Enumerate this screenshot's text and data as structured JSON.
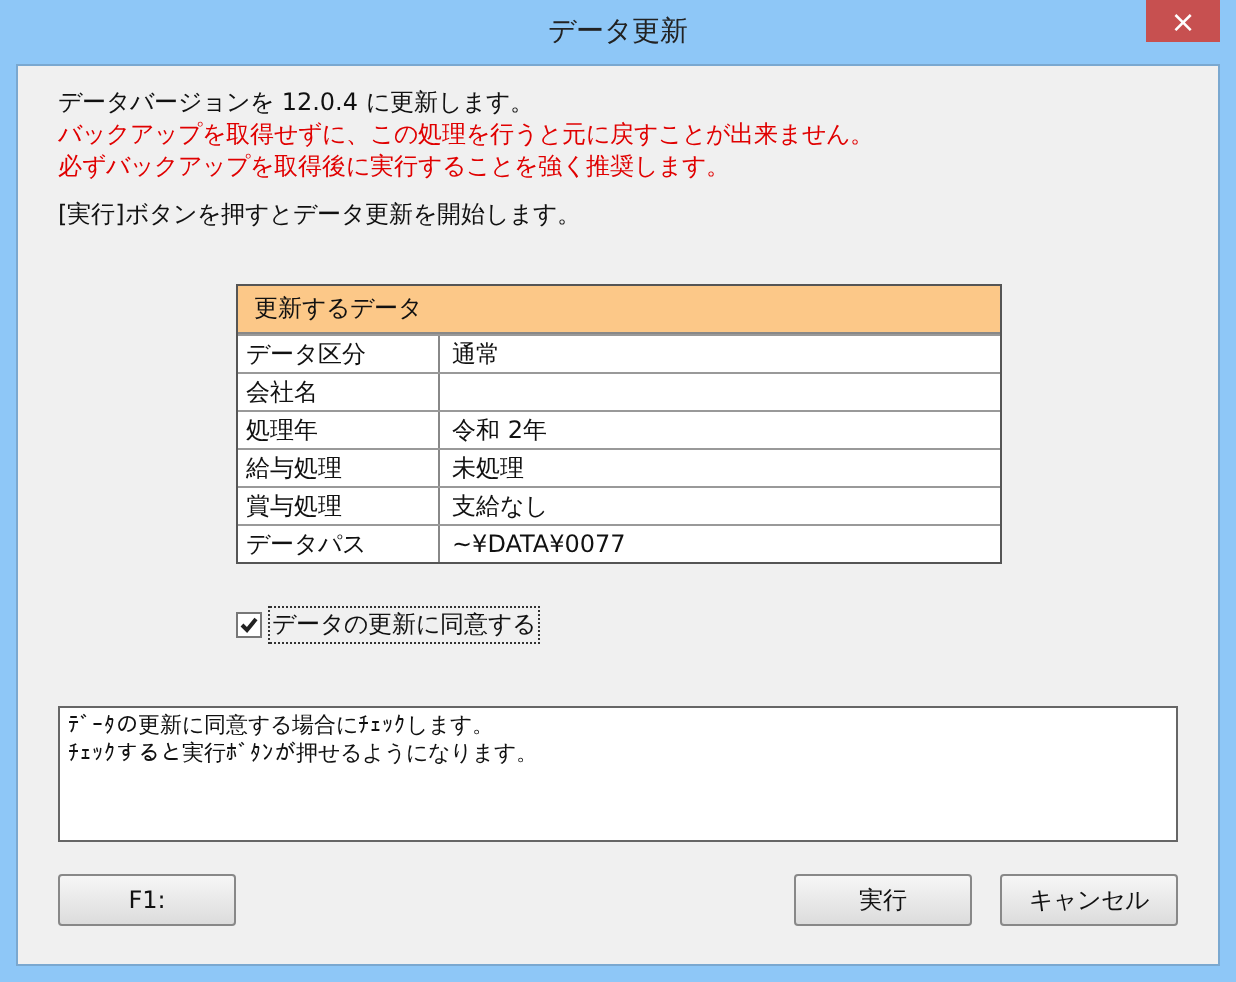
{
  "window": {
    "title": "データ更新",
    "close": "×"
  },
  "messages": [
    {
      "text": "データバージョンを 12.0.4 に更新します。",
      "kind": "normal"
    },
    {
      "text": "バックアップを取得せずに、この処理を行うと元に戻すことが出来ません。",
      "kind": "warning"
    },
    {
      "text": "必ずバックアップを取得後に実行することを強く推奨します。",
      "kind": "warning"
    }
  ],
  "instruction": "[実行]ボタンを押すとデータ更新を開始します。",
  "table": {
    "title": "更新するデータ",
    "rows": [
      {
        "label": "データ区分",
        "value": "通常"
      },
      {
        "label": "会社名"
      },
      {
        "label": "処理年",
        "value": "令和 2年"
      },
      {
        "label": "給与処理",
        "value": "未処理"
      },
      {
        "label": "賞与処理",
        "value": "支給なし"
      },
      {
        "label": "データパス",
        "value": "~¥DATA¥0077"
      }
    ]
  },
  "agree": {
    "label": "データの更新に同意する",
    "checked": true
  },
  "note": [
    "ﾃﾞｰﾀの更新に同意する場合にﾁｪｯｸします。",
    "ﾁｪｯｸすると実行ﾎﾞﾀﾝが押せるようになります。"
  ],
  "buttons": {
    "help": "F1:",
    "run": "実行",
    "cancel": "キャンセル"
  }
}
